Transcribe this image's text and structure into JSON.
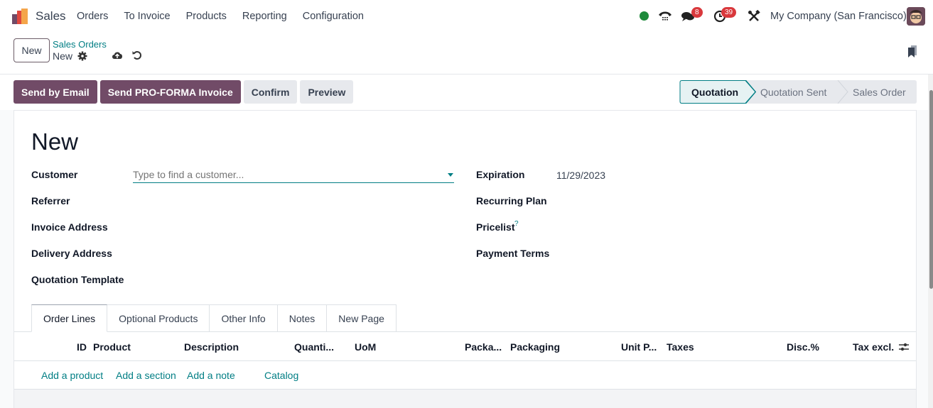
{
  "navbar": {
    "app_name": "Sales",
    "menu": [
      "Orders",
      "To Invoice",
      "Products",
      "Reporting",
      "Configuration"
    ],
    "messages_badge": "8",
    "activities_badge": "39",
    "company": "My Company (San Francisco)",
    "status_color": "#1d8a3a"
  },
  "control_panel": {
    "new_label": "New",
    "breadcrumb_parent": "Sales Orders",
    "breadcrumb_current": "New"
  },
  "actions": {
    "send_email": "Send by Email",
    "send_proforma": "Send PRO-FORMA Invoice",
    "confirm": "Confirm",
    "preview": "Preview"
  },
  "statusbar": {
    "stages": [
      "Quotation",
      "Quotation Sent",
      "Sales Order"
    ],
    "active": "Quotation"
  },
  "form": {
    "title": "New",
    "left_fields": {
      "customer": "Customer",
      "referrer": "Referrer",
      "invoice_address": "Invoice Address",
      "delivery_address": "Delivery Address",
      "quotation_template": "Quotation Template"
    },
    "customer_placeholder": "Type to find a customer...",
    "right_fields": {
      "expiration": "Expiration",
      "recurring_plan": "Recurring Plan",
      "pricelist": "Pricelist",
      "payment_terms": "Payment Terms"
    },
    "expiration_value": "11/29/2023",
    "help_mark": "?"
  },
  "notebook": {
    "tabs": [
      "Order Lines",
      "Optional Products",
      "Other Info",
      "Notes",
      "New Page"
    ],
    "active_tab": "Order Lines"
  },
  "order_lines": {
    "columns": [
      "ID",
      "Product",
      "Description",
      "Quanti...",
      "UoM",
      "Packa...",
      "Packaging",
      "Unit P...",
      "Taxes",
      "Disc.%",
      "Tax excl."
    ],
    "add_links": [
      "Add a product",
      "Add a section",
      "Add a note",
      "Catalog"
    ]
  },
  "colors": {
    "primary": "#714b67",
    "link": "#017e84"
  }
}
